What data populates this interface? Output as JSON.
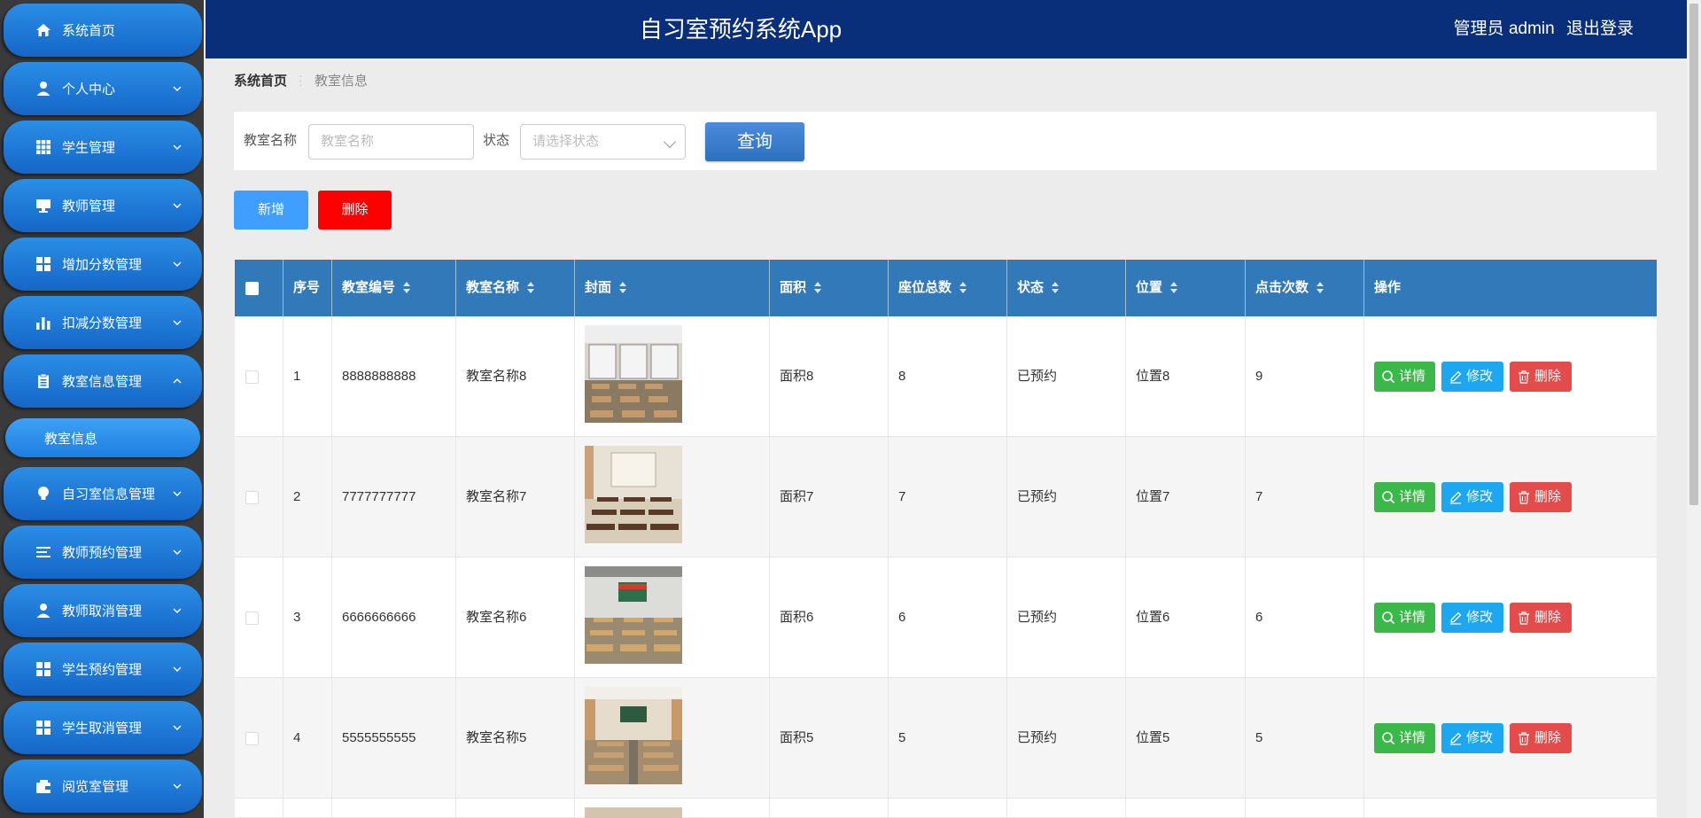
{
  "header": {
    "title": "自习室预约系统App",
    "user_label": "管理员 admin",
    "logout_label": "退出登录"
  },
  "sidebar": {
    "items": [
      {
        "label": "系统首页",
        "icon": "home-icon"
      },
      {
        "label": "个人中心",
        "icon": "user-icon"
      },
      {
        "label": "学生管理",
        "icon": "grid-icon"
      },
      {
        "label": "教师管理",
        "icon": "monitor-icon"
      },
      {
        "label": "增加分数管理",
        "icon": "grid-icon"
      },
      {
        "label": "扣减分数管理",
        "icon": "bar-chart-icon"
      },
      {
        "label": "教室信息管理",
        "icon": "clipboard-icon"
      },
      {
        "label": "自习室信息管理",
        "icon": "bulb-icon"
      },
      {
        "label": "教师预约管理",
        "icon": "list-icon"
      },
      {
        "label": "教师取消管理",
        "icon": "user-icon"
      },
      {
        "label": "学生预约管理",
        "icon": "grid-icon"
      },
      {
        "label": "学生取消管理",
        "icon": "grid-icon"
      },
      {
        "label": "阅览室管理",
        "icon": "wallet-icon"
      }
    ],
    "subitem": {
      "label": "教室信息"
    }
  },
  "breadcrumb": {
    "home": "系统首页",
    "current": "教室信息"
  },
  "search": {
    "name_label": "教室名称",
    "name_placeholder": "教室名称",
    "status_label": "状态",
    "status_placeholder": "请选择状态",
    "query_label": "查询"
  },
  "actions": {
    "add_label": "新增",
    "delete_label": "删除"
  },
  "table": {
    "columns": [
      "序号",
      "教室编号",
      "教室名称",
      "封面",
      "面积",
      "座位总数",
      "状态",
      "位置",
      "点击次数",
      "操作"
    ],
    "row_actions": {
      "detail": "详情",
      "edit": "修改",
      "remove": "删除"
    },
    "rows": [
      {
        "index": "1",
        "code": "8888888888",
        "name": "教室名称8",
        "area": "面积8",
        "seats": "8",
        "status": "已预约",
        "location": "位置8",
        "clicks": "9"
      },
      {
        "index": "2",
        "code": "7777777777",
        "name": "教室名称7",
        "area": "面积7",
        "seats": "7",
        "status": "已预约",
        "location": "位置7",
        "clicks": "7"
      },
      {
        "index": "3",
        "code": "6666666666",
        "name": "教室名称6",
        "area": "面积6",
        "seats": "6",
        "status": "已预约",
        "location": "位置6",
        "clicks": "6"
      },
      {
        "index": "4",
        "code": "5555555555",
        "name": "教室名称5",
        "area": "面积5",
        "seats": "5",
        "status": "已预约",
        "location": "位置5",
        "clicks": "5"
      }
    ]
  },
  "colors": {
    "header_bg": "#0a2f7a",
    "table_head": "#3279ba",
    "add": "#409eff",
    "delete": "#ff0000",
    "detail": "#3bb84a",
    "edit": "#1ca7f0",
    "remove": "#e44b4b"
  }
}
